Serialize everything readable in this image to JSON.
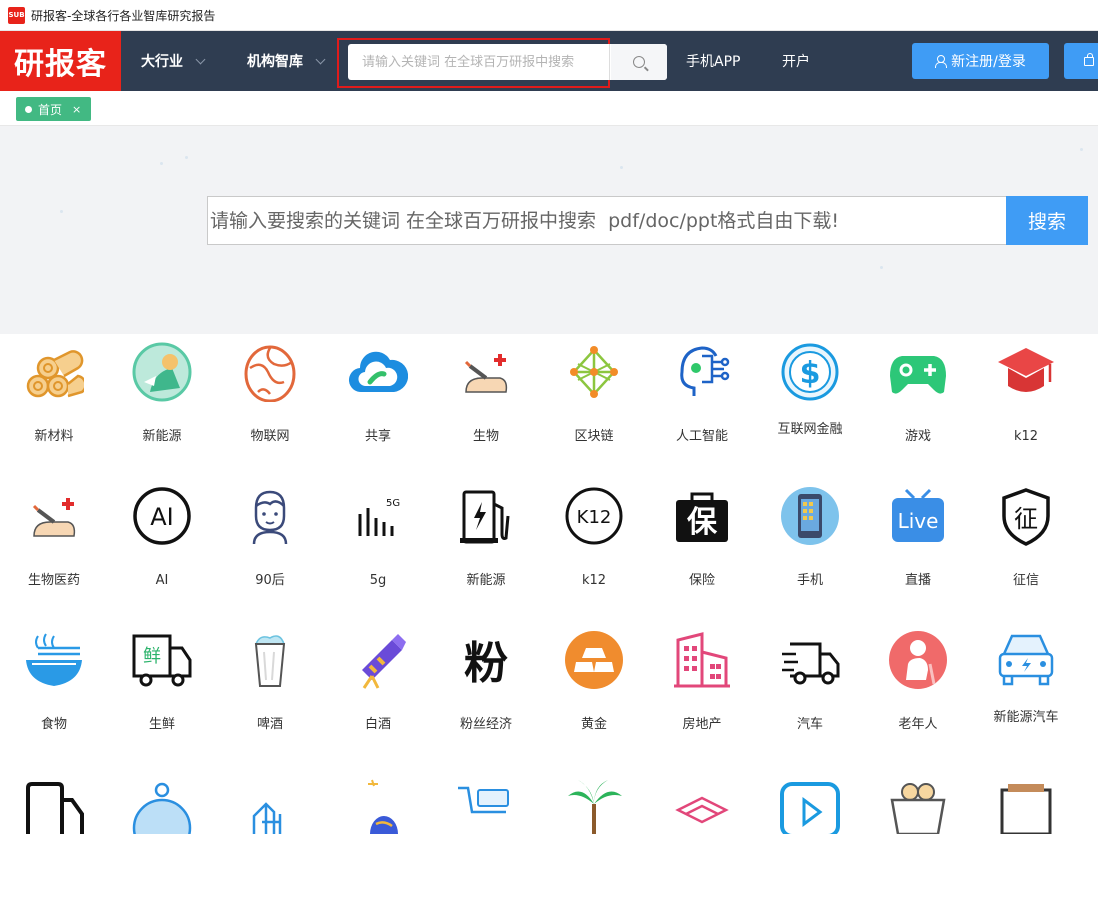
{
  "window": {
    "title": "研报客-全球各行各业智库研究报告",
    "logo_text": "SUB"
  },
  "header": {
    "brand": "研报客",
    "nav": [
      "大行业",
      "机构智库"
    ],
    "search_placeholder": "请输入关键词 在全球百万研报中搜索",
    "links": [
      "手机APP",
      "开户"
    ],
    "register_label": "新注册/登录"
  },
  "tabs": {
    "home": "首页",
    "close": "×"
  },
  "hero": {
    "placeholder": "请输入要搜索的关键词 在全球百万研报中搜索  pdf/doc/ppt格式自由下载!",
    "button": "搜索"
  },
  "categories": [
    {
      "label": "新材料",
      "icon": "rolls-icon"
    },
    {
      "label": "新能源",
      "icon": "green-energy-icon"
    },
    {
      "label": "物联网",
      "icon": "globe-egg-icon"
    },
    {
      "label": "共享",
      "icon": "cloud-icon"
    },
    {
      "label": "生物",
      "icon": "syringe-icon"
    },
    {
      "label": "区块链",
      "icon": "blockchain-icon"
    },
    {
      "label": "人工智能",
      "icon": "ai-head-icon"
    },
    {
      "label": "互联网金融",
      "icon": "dollar-coin-icon"
    },
    {
      "label": "游戏",
      "icon": "gamepad-icon"
    },
    {
      "label": "k12",
      "icon": "graduation-cap-icon"
    },
    {
      "label": "生物医药",
      "icon": "syringe-icon"
    },
    {
      "label": "AI",
      "icon": "ai-circle-icon"
    },
    {
      "label": "90后",
      "icon": "boy-face-icon"
    },
    {
      "label": "5g",
      "icon": "signal-5g-icon"
    },
    {
      "label": "新能源",
      "icon": "charging-station-icon"
    },
    {
      "label": "k12",
      "icon": "k12-circle-icon"
    },
    {
      "label": "保险",
      "icon": "insurance-bag-icon"
    },
    {
      "label": "手机",
      "icon": "phone-icon"
    },
    {
      "label": "直播",
      "icon": "live-tv-icon"
    },
    {
      "label": "征信",
      "icon": "shield-credit-icon"
    },
    {
      "label": "食物",
      "icon": "bowl-icon"
    },
    {
      "label": "生鲜",
      "icon": "fresh-truck-icon"
    },
    {
      "label": "啤酒",
      "icon": "beer-icon"
    },
    {
      "label": "白酒",
      "icon": "telescope-icon"
    },
    {
      "label": "粉丝经济",
      "icon": "fans-icon"
    },
    {
      "label": "黄金",
      "icon": "gold-icon"
    },
    {
      "label": "房地产",
      "icon": "building-icon"
    },
    {
      "label": "汽车",
      "icon": "truck-icon"
    },
    {
      "label": "老年人",
      "icon": "elder-icon"
    },
    {
      "label": "新能源汽车",
      "icon": "ev-car-icon"
    }
  ],
  "colors": {
    "header_bg": "#2f3d51",
    "brand_red": "#e8231a",
    "accent_blue": "#3f9cf5",
    "tab_green": "#42b983",
    "highlight_red": "#e01b1b"
  }
}
